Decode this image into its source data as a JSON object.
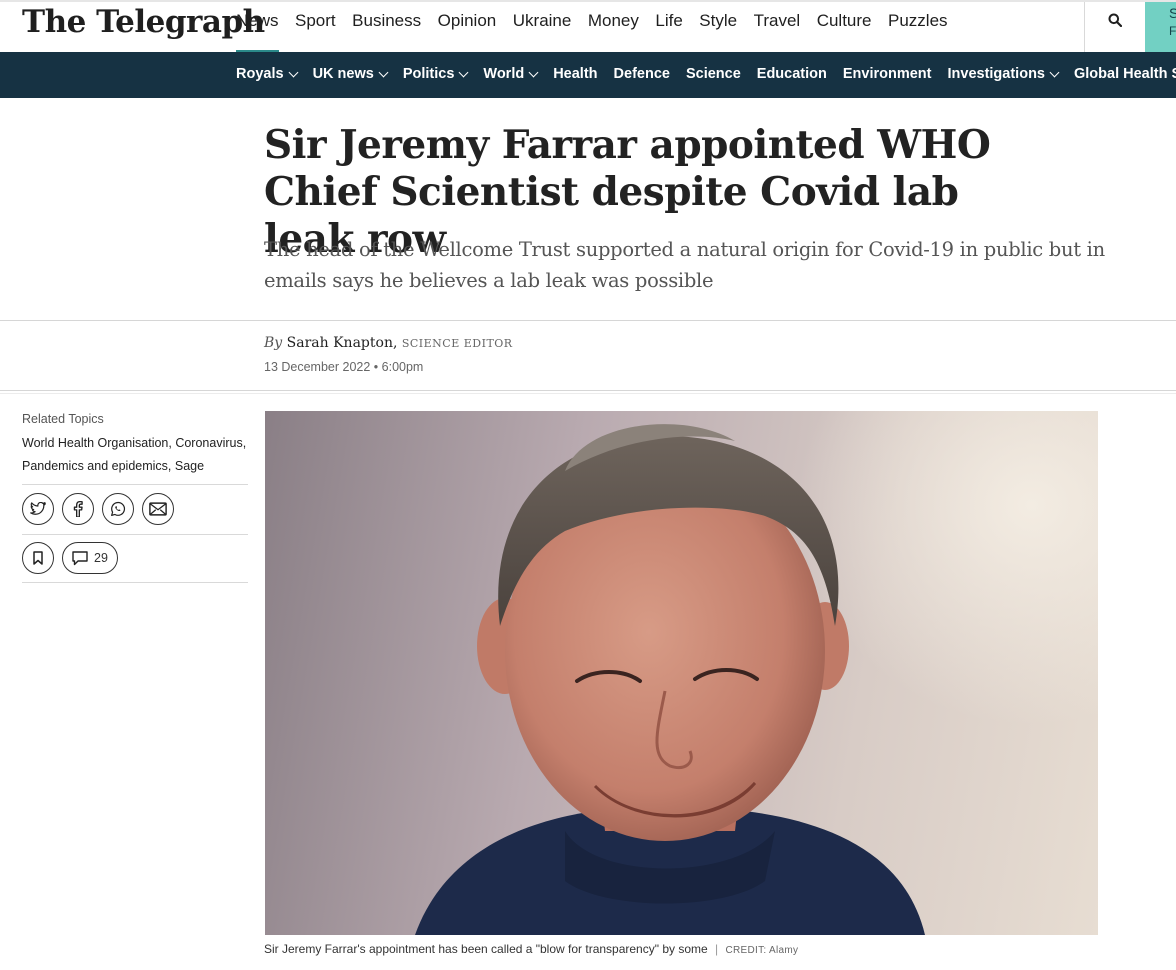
{
  "brand": {
    "logo_text": "The Telegraph"
  },
  "primary_nav": [
    "News",
    "Sport",
    "Business",
    "Opinion",
    "Ukraine",
    "Money",
    "Life",
    "Style",
    "Travel",
    "Culture",
    "Puzzles"
  ],
  "primary_active": "News",
  "cta": {
    "line1": "S",
    "line2": "F"
  },
  "sub_nav": [
    {
      "label": "Royals",
      "dropdown": true
    },
    {
      "label": "UK news",
      "dropdown": true
    },
    {
      "label": "Politics",
      "dropdown": true
    },
    {
      "label": "World",
      "dropdown": true
    },
    {
      "label": "Health",
      "dropdown": false
    },
    {
      "label": "Defence",
      "dropdown": false
    },
    {
      "label": "Science",
      "dropdown": false
    },
    {
      "label": "Education",
      "dropdown": false
    },
    {
      "label": "Environment",
      "dropdown": false
    },
    {
      "label": "Investigations",
      "dropdown": true
    },
    {
      "label": "Global Health Security",
      "dropdown": false
    }
  ],
  "article": {
    "headline": "Sir Jeremy Farrar appointed WHO Chief Scientist despite Covid lab leak row",
    "standfirst": "The head of the Wellcome Trust supported a natural origin for Covid-19 in public but in emails says he believes a lab leak was possible",
    "byline_prefix": "By",
    "author": "Sarah Knapton,",
    "author_role": "SCIENCE EDITOR",
    "date": "13 December 2022 • 6:00pm",
    "caption": "Sir Jeremy Farrar's appointment has been called a \"blow for transparency\" by some",
    "caption_sep": "|",
    "credit": "CREDIT: Alamy"
  },
  "sidebar": {
    "related_label": "Related Topics",
    "topics": [
      "World Health Organisation",
      "Coronavirus",
      "Pandemics and epidemics",
      "Sage"
    ],
    "comment_count": "29"
  },
  "colors": {
    "navy": "#163243",
    "teal": "#72d0c3",
    "accent": "#2b8a8a"
  },
  "icons": [
    "search-icon",
    "twitter-icon",
    "facebook-icon",
    "whatsapp-icon",
    "email-icon",
    "bookmark-icon",
    "comment-icon"
  ]
}
